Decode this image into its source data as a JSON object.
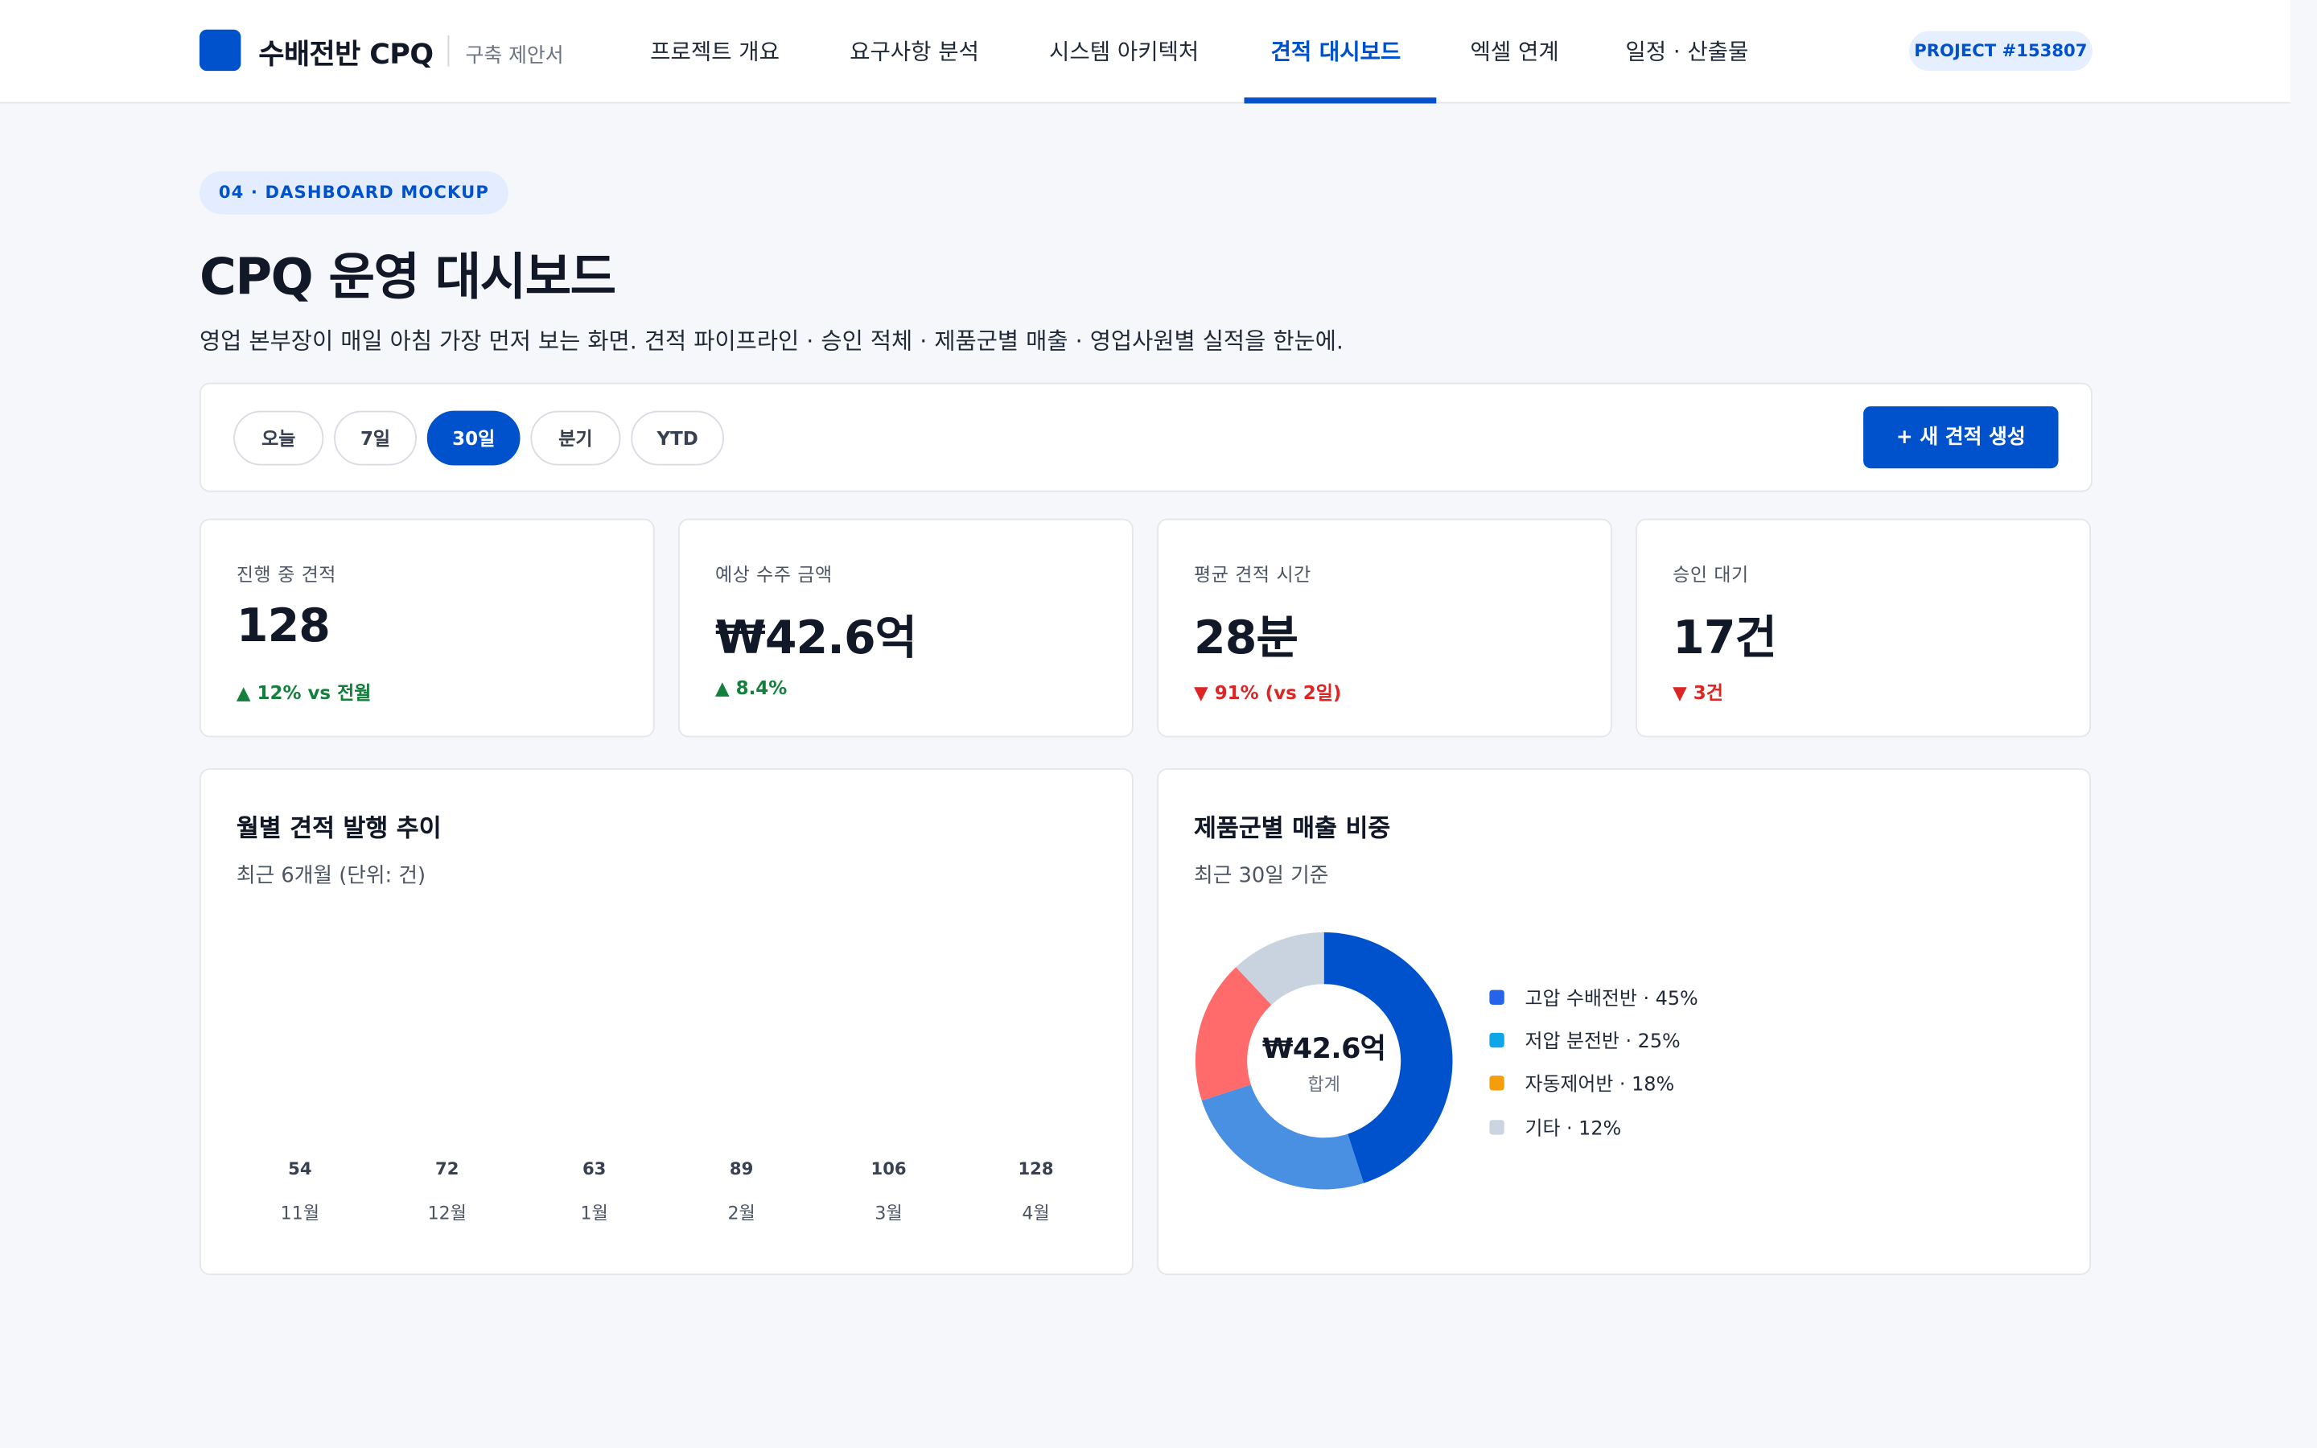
{
  "header": {
    "brand": "수배전반 CPQ",
    "brand_sub": "구축 제안서",
    "nav": [
      "프로젝트 개요",
      "요구사항 분석",
      "시스템 아키텍처",
      "견적 대시보드",
      "엑셀 연계",
      "일정 · 산출물"
    ],
    "active_nav": "견적 대시보드",
    "project_badge": "PROJECT #153807"
  },
  "page": {
    "eyebrow": "04 · DASHBOARD MOCKUP",
    "title": "CPQ 운영 대시보드",
    "description": "영업 본부장이 매일 아침 가장 먼저 보는 화면. 견적 파이프라인 · 승인 적체 · 제품군별 매출 · 영업사원별 실적을 한눈에."
  },
  "filters": {
    "periods": [
      "오늘",
      "7일",
      "30일",
      "분기",
      "YTD"
    ],
    "selected": "30일",
    "new_quote_label": "+ 새 견적 생성"
  },
  "kpis": [
    {
      "label": "진행 중 견적",
      "value": "128",
      "delta": "▲ 12% vs 전월",
      "trend": "up"
    },
    {
      "label": "예상 수주 금액",
      "value": "₩42.6억",
      "delta": "▲ 8.4%",
      "trend": "up"
    },
    {
      "label": "평균 견적 시간",
      "value": "28분",
      "delta": "▼ 91% (vs 2일)",
      "trend": "down"
    },
    {
      "label": "승인 대기",
      "value": "17건",
      "delta": "▼ 3건",
      "trend": "down"
    }
  ],
  "colors": {
    "accent": "#0052cc",
    "positive": "#15803d",
    "negative": "#dc2626"
  },
  "chart_data": [
    {
      "type": "bar",
      "title": "월별 견적 발행 추이",
      "subtitle": "최근 6개월 (단위: 건)",
      "categories": [
        "11월",
        "12월",
        "1월",
        "2월",
        "3월",
        "4월"
      ],
      "values": [
        54,
        72,
        63,
        89,
        106,
        128
      ]
    },
    {
      "type": "pie",
      "title": "제품군별 매출 비중",
      "subtitle": "최근 30일 기준",
      "center_value": "₩42.6억",
      "center_caption": "합계",
      "slices": [
        {
          "label": "고압 수배전반 · 45%",
          "value": 45,
          "color": "#0052cc",
          "legend_color": "#2563eb"
        },
        {
          "label": "저압 분전반 · 25%",
          "value": 25,
          "color": "#4a90e2",
          "legend_color": "#0ea5e9"
        },
        {
          "label": "자동제어반 · 18%",
          "value": 18,
          "color": "#ff6b6b",
          "legend_color": "#f59e0b"
        },
        {
          "label": "기타 · 12%",
          "value": 12,
          "color": "#c8d3df",
          "legend_color": "#cbd5e1"
        }
      ]
    }
  ]
}
